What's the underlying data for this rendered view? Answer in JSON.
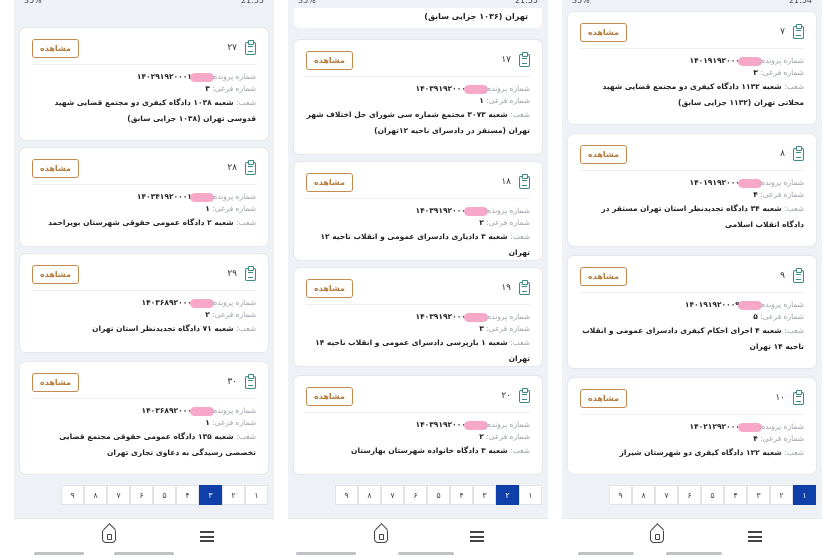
{
  "labels": {
    "case_number": "شماره پرونده:",
    "sub_number": "شماره فرعی:",
    "branch": "شعب:",
    "view_button": "مشاهده"
  },
  "panels": [
    {
      "status_left": "21:55",
      "status_right": "35%",
      "cards": [
        {
          "index": "۲۷",
          "case_number_visible": "۱۴۰۲۹۱۹۲۰۰۰۱۳",
          "sub_number": "۳",
          "branch": "شعبه ۱۰۳۸ دادگاه کیفری دو مجتمع قضایی شهید قدوسی تهران (۱۰۳۸ جزایی سابق)"
        },
        {
          "index": "۲۸",
          "case_number_visible": "۱۴۰۳۴۱۹۲۰۰۰۱۳",
          "sub_number": "۱",
          "branch": "شعبه ۲ دادگاه عمومی حقوقی شهرستان بویراحمد"
        },
        {
          "index": "۲۹",
          "case_number_visible": "۱۴۰۳۶۸۹۲۰۰۰۲",
          "sub_number": "۲",
          "branch": "شعبه ۷۱ دادگاه تجدیدنظر استان تهران"
        },
        {
          "index": "۳۰",
          "case_number_visible": "۱۴۰۳۶۸۹۲۰۰۰۳",
          "sub_number": "۱",
          "branch": "شعبه ۱۳۵ دادگاه عمومی حقوقی مجتمع قضایی تخصصی رسیدگی به دعاوی تجاری تهران"
        }
      ],
      "pages": [
        "۱",
        "۲",
        "۳",
        "۴",
        "۵",
        "۶",
        "۷",
        "۸",
        "۹"
      ],
      "active_page": "۳"
    },
    {
      "status_left": "21:55",
      "status_right": "35%",
      "top_text": "تهران (۱۰۳۶ جزایی سابق)",
      "cards": [
        {
          "index": "۱۷",
          "case_number_visible": "۱۴۰۳۹۱۹۲۰۰۰۷",
          "sub_number": "۱",
          "branch": "شعبه ۳۰۷۳ مجتمع شماره سی شورای حل اختلاف شهر تهران (مستقر در دادسرای ناحیه ۱۲تهران)"
        },
        {
          "index": "۱۸",
          "case_number_visible": "۱۴۰۳۹۱۹۲۰۰۰۷",
          "sub_number": "۲",
          "branch": "شعبه ۳ دادیاری دادسرای عمومی و انقلاب ناحیه ۱۲ تهران"
        },
        {
          "index": "۱۹",
          "case_number_visible": "۱۴۰۳۹۱۹۲۰۰۰۷",
          "sub_number": "۳",
          "branch": "شعبه ۱ بازپرسی دادسرای عمومی و انقلاب ناحیه ۱۴ تهران"
        },
        {
          "index": "۲۰",
          "case_number_visible": "۱۴۰۳۹۱۹۲۰۰۰۸",
          "sub_number": "۲",
          "branch": "شعبه ۳ دادگاه خانواده شهرستان بهارستان"
        }
      ],
      "pages": [
        "۱",
        "۲",
        "۳",
        "۴",
        "۵",
        "۶",
        "۷",
        "۸",
        "۹"
      ],
      "active_page": "۲"
    },
    {
      "status_left": "21:54",
      "status_right": "35%",
      "cards": [
        {
          "index": "۷",
          "case_number_visible": "۱۴۰۱۹۱۹۲۰۰۰۹",
          "sub_number": "۳",
          "branch": "شعبه ۱۱۳۲ دادگاه کیفری دو مجتمع قضایی شهید محلاتی تهران (۱۱۳۲ جزایی سابق)"
        },
        {
          "index": "۸",
          "case_number_visible": "۱۴۰۱۹۱۹۲۰۰۰۹",
          "sub_number": "۴",
          "branch": "شعبه ۳۴ دادگاه تجدیدنظر استان تهران مستقر در دادگاه انقلاب اسلامی"
        },
        {
          "index": "۹",
          "case_number_visible": "۱۴۰۱۹۱۹۲۰۰۰۹۸",
          "sub_number": "۵",
          "branch": "شعبه ۴ اجرای احکام کیفری دادسرای عمومی و انقلاب ناحیه ۱۴ تهران"
        },
        {
          "index": "۱۰",
          "case_number_visible": "۱۴۰۲۱۲۹۲۰۰۰۳",
          "sub_number": "۴",
          "branch": "شعبه ۱۲۲ دادگاه کیفری دو شهرستان شیراز"
        }
      ],
      "pages": [
        "۱",
        "۲",
        "۳",
        "۴",
        "۵",
        "۶",
        "۷",
        "۸",
        "۹"
      ],
      "active_page": "۱"
    }
  ]
}
